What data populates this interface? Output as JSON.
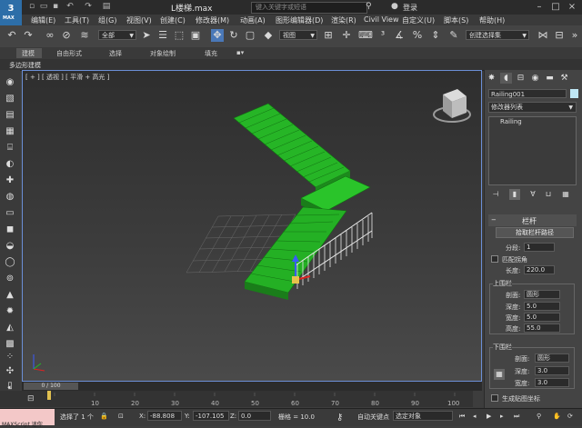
{
  "app": {
    "logo_text": "3",
    "logo_sub": "MAX",
    "window_title": "L楼梯.max"
  },
  "search": {
    "placeholder": "键入关键字或短语",
    "login": "登录"
  },
  "menu": [
    "编辑(E)",
    "工具(T)",
    "组(G)",
    "视图(V)",
    "创建(C)",
    "修改器(M)",
    "动画(A)",
    "图形编辑器(D)",
    "渲染(R)",
    "Civil View",
    "自定义(U)",
    "脚本(S)",
    "帮助(H)"
  ],
  "toolbar": {
    "selection_filter": "全部",
    "reference_coord": "视图",
    "named_selection": "创建选择集"
  },
  "ribbon": {
    "tabs": [
      "建模",
      "自由形式",
      "选择",
      "对象绘制",
      "填充"
    ],
    "subtab": "多边形建模"
  },
  "viewport": {
    "label": "[ + ] [ 透视 ] [ 平滑 + 高光 ]"
  },
  "timeline": {
    "frame": "0 / 100",
    "ticks": [
      "10",
      "20",
      "30",
      "40",
      "50",
      "60",
      "70",
      "80",
      "90",
      "100"
    ]
  },
  "status": {
    "maxscript": "MAXScript 迷你",
    "selected": "选择了 1 个",
    "x_label": "X:",
    "x": "-88.808",
    "y_label": "Y:",
    "y": "-107.105",
    "z_label": "Z:",
    "z": "0.0",
    "grid": "栅格 = 10.0",
    "auto_key": "自动关键点",
    "selected_obj": "选定对象"
  },
  "command_panel": {
    "object_name": "Railing001",
    "modifier_list": "修改器列表",
    "stack_item": "Railing",
    "rollout_title": "栏杆",
    "pick_path": "拾取栏杆路径",
    "segments_label": "分段:",
    "segments": "1",
    "match_corners": "匹配拐角",
    "length_label": "长度:",
    "length": "220.0",
    "top_rail_label": "上围栏",
    "profile_label": "剖面:",
    "top_profile": "圆形",
    "depth_label": "深度:",
    "top_depth": "5.0",
    "width_label": "宽度:",
    "top_width": "5.0",
    "height_label": "高度:",
    "top_height": "55.0",
    "lower_rail_label": "下围栏",
    "lower_profile": "圆形",
    "lower_depth": "3.0",
    "lower_width": "3.0",
    "gen_mapping": "生成贴图坐标"
  }
}
